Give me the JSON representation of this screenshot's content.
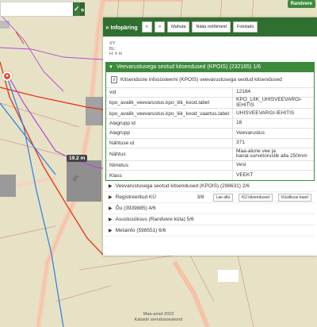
{
  "search": {
    "value": "",
    "submit_icon": "check-icon",
    "collapse_icon": "double-chevron-down-icon"
  },
  "map": {
    "village_label": "Randvere",
    "measurement": "19.2 m",
    "parcel_label": "0/1",
    "attribution_line1": "Maa-amet 2023",
    "attribution_line2": "Katastri arendusosakond",
    "colors": {
      "background": "#e7e2c6",
      "road": "#f4c3a8",
      "red_line": "#e53a1e",
      "blue_line": "#2b7de0",
      "purple_line": "#b44adf",
      "building": "#8a8a8a"
    }
  },
  "panel": {
    "title": "Infopäring",
    "buttons": {
      "prev": "<",
      "next": ">",
      "clear": "Mahuta",
      "show_all": "Näita mõõtmeid",
      "photo": "Fotolado"
    },
    "coords": {
      "xy": "XY:",
      "bl": "BL:",
      "h": "H: 6 m"
    },
    "open_section": {
      "title": "Veevarustusega seotud kitsendused (KPOIS) (232165) 1/6",
      "notice": "Kitsenduste infosüsteemi (KPOIS) veevarustusega seotud kitsendused",
      "rows": [
        {
          "key": "vid",
          "value": "12184"
        },
        {
          "key": "kpo_avalik_veevarustus.kpo_liik_kood.label",
          "value": "KPO_LIIK_UHISVEEVARGI-IEHITIS"
        },
        {
          "key": "kpo_avalik_veevarustus.kpo_liik_kood_vaartus.label",
          "value": "UHISVEEVARGI-IEHITIS"
        },
        {
          "key": "Alagrupp id",
          "value": "16"
        },
        {
          "key": "Alagrupp",
          "value": "Veevarustus"
        },
        {
          "key": "Nähtuse id",
          "value": "371"
        },
        {
          "key": "Nähtus",
          "value": "Maa-alune vee ja kanal.survetorustik alla 250mm"
        },
        {
          "key": "Nimetus",
          "value": "Vesi"
        },
        {
          "key": "Klass",
          "value": "VEEKT"
        }
      ]
    },
    "closed_sections": [
      {
        "title": "Veevarustusega seotud kitsendused (KPOIS) (298631) 2/6"
      }
    ],
    "registry": {
      "title": "Registreeritud KÜ",
      "count": "3/6",
      "btn_load": "Lae alla",
      "btn_ku": "KÜ kitsendused",
      "btn_map": "Küsilkuse kaart"
    },
    "more_sections": [
      {
        "title": "Õu (3939885) 4/6"
      },
      {
        "title": "Asustusüksus (Randvere küla) 5/6"
      },
      {
        "title": "Metainfo (598551) 6/6"
      }
    ]
  }
}
